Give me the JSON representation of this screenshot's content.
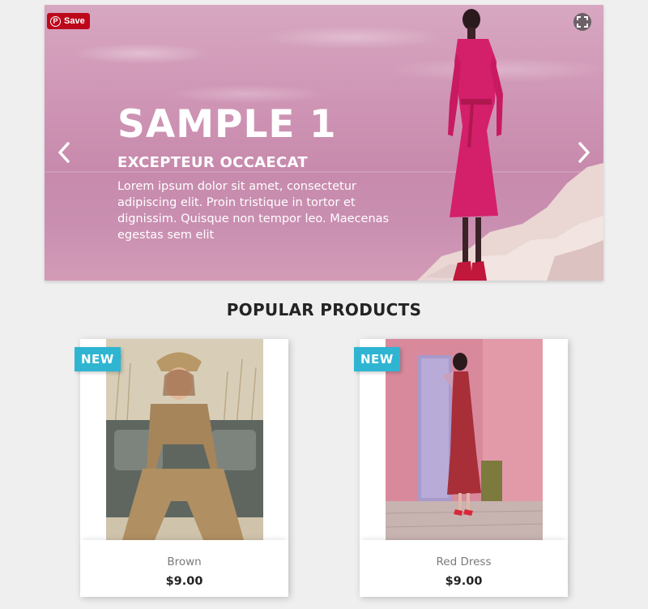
{
  "slider": {
    "pin_save_label": "Save",
    "title": "SAMPLE 1",
    "subtitle": "EXCEPTEUR OCCAECAT",
    "text": "Lorem ipsum dolor sit amet, consectetur adipiscing elit. Proin tristique in tortor et dignissim. Quisque non tempor leo. Maecenas egestas sem elit",
    "icons": {
      "prev": "chevron-left-icon",
      "next": "chevron-right-icon",
      "expand": "expand-icon",
      "pin": "pinterest-icon"
    }
  },
  "popular": {
    "heading": "POPULAR PRODUCTS",
    "products": [
      {
        "badge": "NEW",
        "name": "Brown",
        "price": "$9.00"
      },
      {
        "badge": "NEW",
        "name": "Red Dress",
        "price": "$9.00"
      }
    ]
  },
  "colors": {
    "badge": "#2fb5d2",
    "pin_save": "#bd081c",
    "slide_bg": "#cf95b5",
    "page_bg": "#efefef"
  }
}
